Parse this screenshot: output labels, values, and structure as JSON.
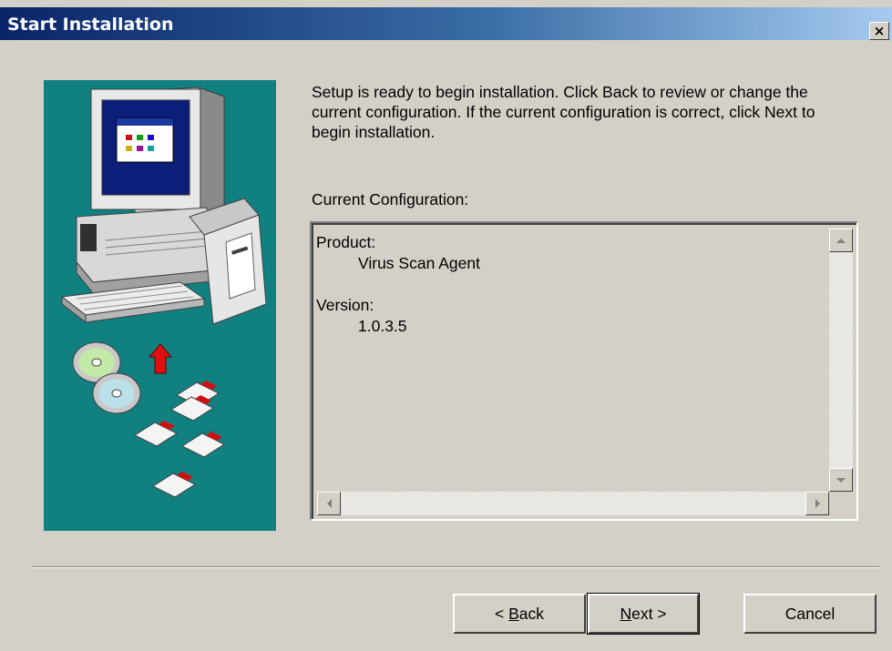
{
  "window": {
    "title": "Start Installation",
    "close_glyph": "×"
  },
  "intro_text": "Setup is ready to begin installation. Click Back to review or change the current configuration. If the current configuration is correct, click Next to begin installation.",
  "config": {
    "label": "Current Configuration:",
    "entries": [
      {
        "key": "Product:",
        "value": "Virus Scan Agent"
      },
      {
        "key": "Version:",
        "value": "1.0.3.5"
      }
    ]
  },
  "buttons": {
    "back": {
      "prefix": "< ",
      "mnemonic": "B",
      "rest": "ack"
    },
    "next": {
      "mnemonic": "N",
      "rest": "ext >"
    },
    "cancel": "Cancel"
  },
  "colors": {
    "dialog_bg": "#d4d0c8",
    "art_bg": "#118080",
    "title_gradient_start": "#0a246a",
    "title_gradient_end": "#a6caf0"
  },
  "icons": {
    "setup_art": "computer-with-cds-and-floppies-illustration",
    "scroll_up": "arrow-up-icon",
    "scroll_down": "arrow-down-icon",
    "scroll_left": "arrow-left-icon",
    "scroll_right": "arrow-right-icon"
  }
}
